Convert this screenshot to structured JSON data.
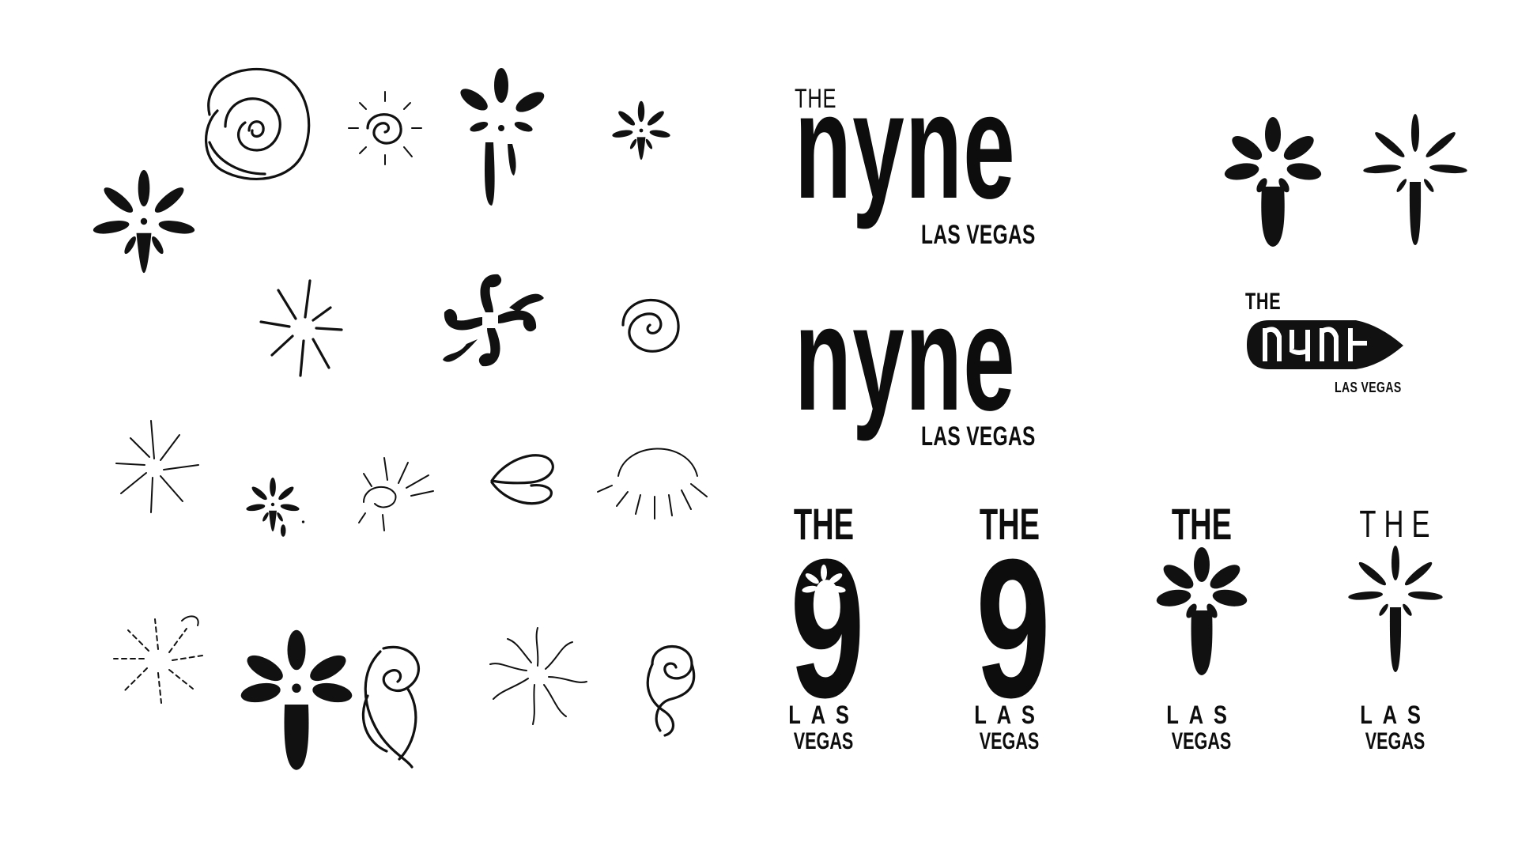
{
  "brand": {
    "the": "THE",
    "name": "nyne",
    "city": "LAS VEGAS",
    "digit": "9",
    "las": "LAS",
    "vegas": "VEGAS"
  },
  "colors": {
    "ink": "#111111",
    "background": "#ffffff"
  },
  "sketch_icons": [
    "large-flower-burst-icon",
    "swirl-shell-icon",
    "spiral-sun-icon",
    "dripping-flower-icon",
    "small-flower-burst-icon",
    "thin-burst-icon",
    "pinwheel-swirl-icon",
    "small-spiral-icon",
    "line-burst-icon",
    "dotted-flower-icon",
    "scribble-burst-icon",
    "petal-outline-icon",
    "dome-rays-icon",
    "dashed-burst-icon",
    "bold-flower-icon",
    "flame-swirl-icon",
    "squiggle-burst-icon",
    "curl-swirl-icon"
  ]
}
